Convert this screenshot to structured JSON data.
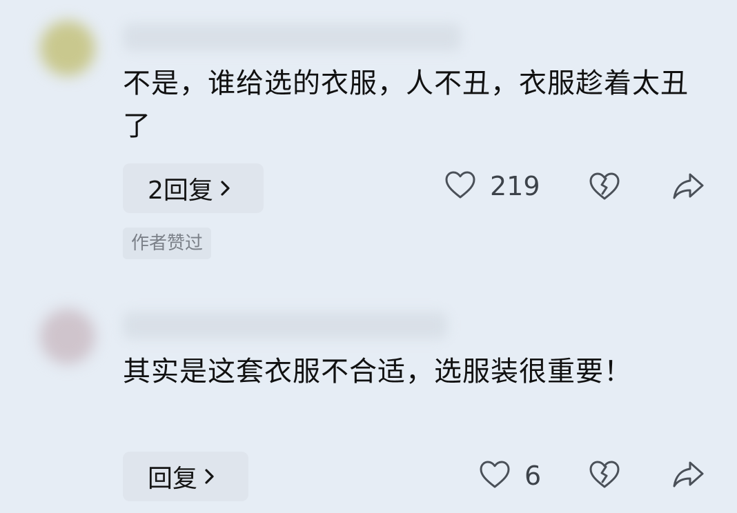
{
  "comments": [
    {
      "text": "不是，谁给选的衣服，人不丑，衣服趁着太丑了",
      "reply_label": "2回复",
      "like_count": "219",
      "author_tag": "作者赞过",
      "avatar_color": "#c9c88e"
    },
    {
      "text": "其实是这套衣服不合适，选服装很重要！",
      "reply_label": "回复",
      "like_count": "6",
      "avatar_color": "#cfc4cc"
    }
  ],
  "icons": {
    "like": "heart-outline-icon",
    "dislike": "broken-heart-icon",
    "share": "share-arrow-icon",
    "chevron": "chevron-right-icon"
  },
  "colors": {
    "background": "#e6edf5",
    "text": "#111111",
    "muted": "#7b8088",
    "icon": "#4a5058"
  }
}
